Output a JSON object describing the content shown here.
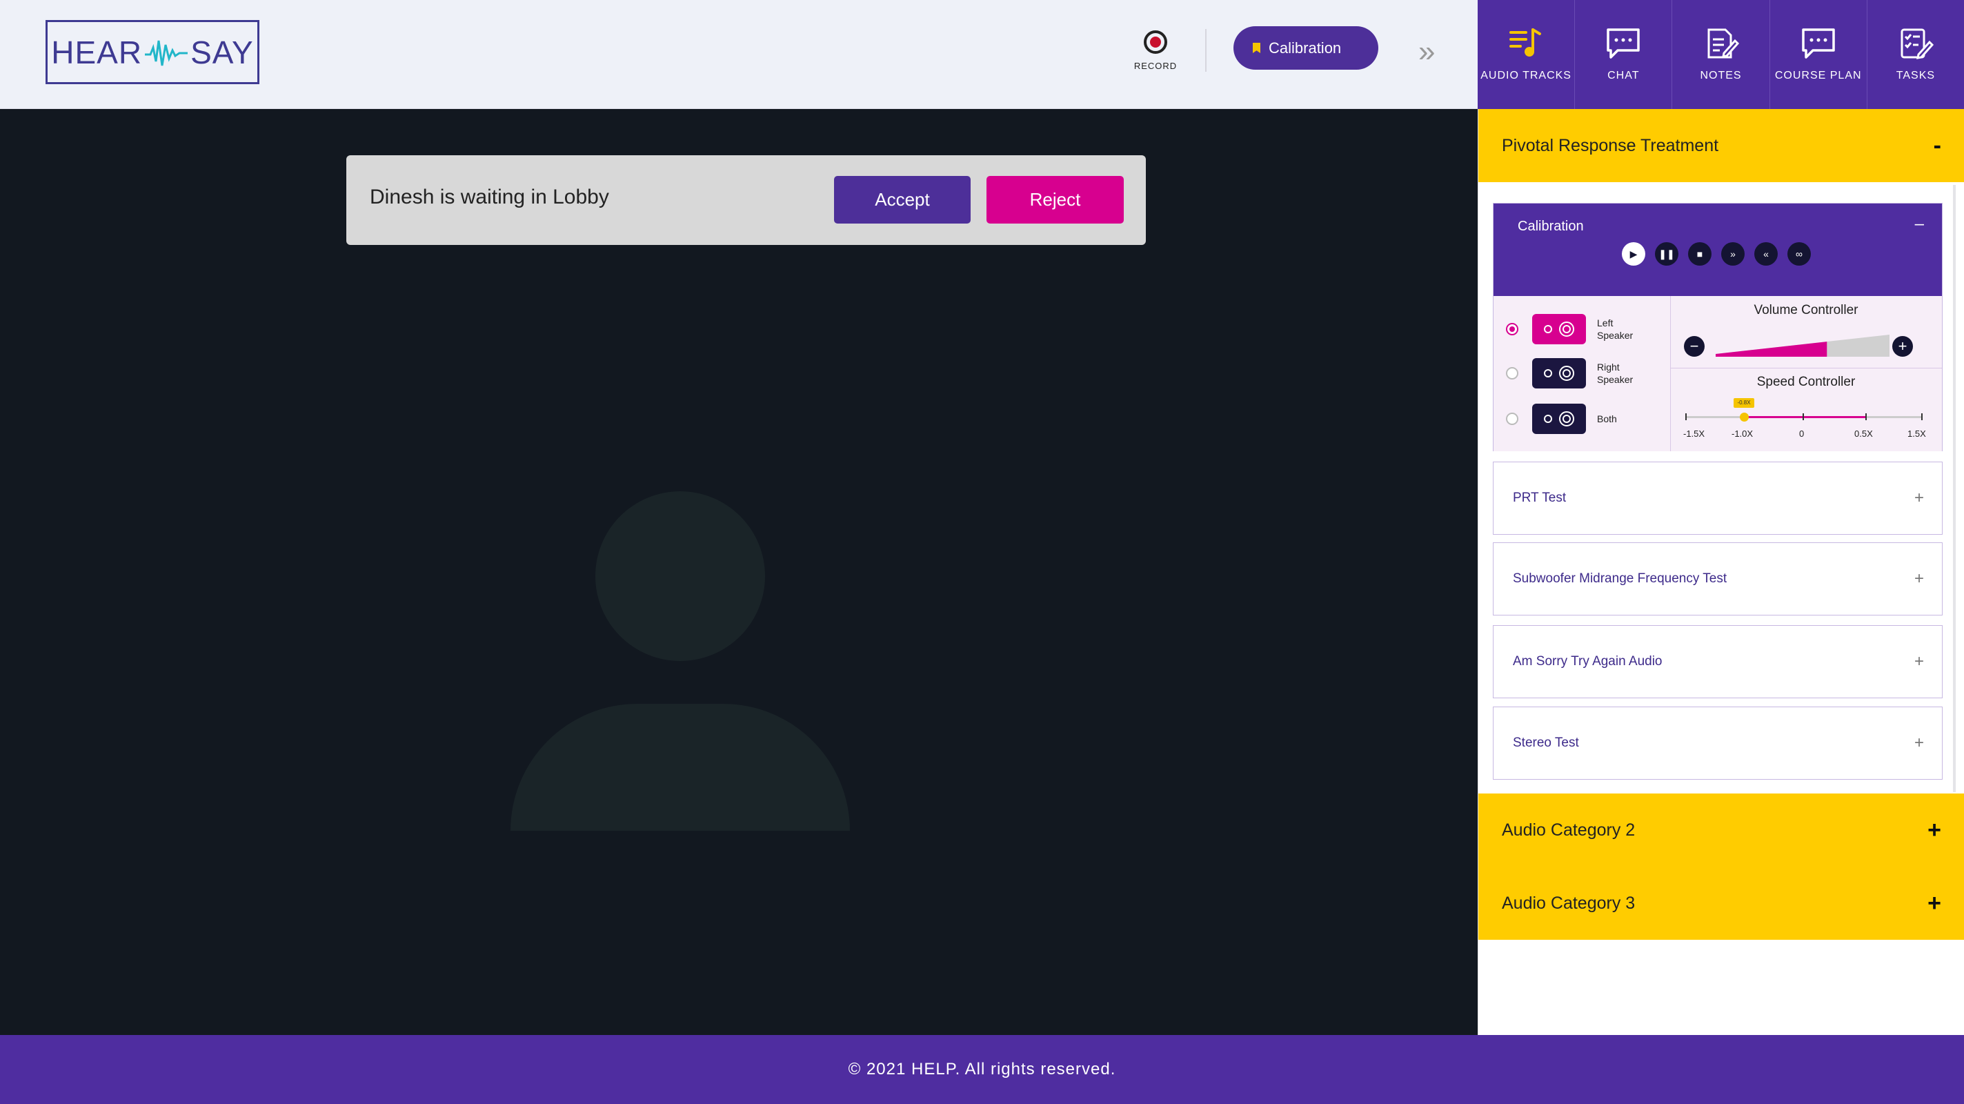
{
  "brand": {
    "left": "HEAR",
    "right": "SAY"
  },
  "header": {
    "record_label": "RECORD",
    "calibration_label": "Calibration",
    "chevron": "»"
  },
  "nav": [
    {
      "label": "AUDIO TRACKS",
      "icon": "audio-tracks-icon",
      "active": true
    },
    {
      "label": "CHAT",
      "icon": "chat-icon"
    },
    {
      "label": "NOTES",
      "icon": "notes-icon"
    },
    {
      "label": "COURSE PLAN",
      "icon": "course-plan-icon"
    },
    {
      "label": "TASKS",
      "icon": "tasks-icon"
    }
  ],
  "lobby": {
    "message": "Dinesh is waiting in Lobby",
    "accept_label": "Accept",
    "reject_label": "Reject"
  },
  "panel": {
    "category1": {
      "title": "Pivotal Response Treatment",
      "toggle": "-"
    },
    "calibration": {
      "title": "Calibration",
      "toggle": "–",
      "speakers": [
        {
          "label": "Left Speaker",
          "selected": true
        },
        {
          "label": "Right Speaker",
          "selected": false
        },
        {
          "label": "Both",
          "selected": false
        }
      ],
      "volume": {
        "title": "Volume Controller",
        "minus": "−",
        "plus": "+",
        "level_fraction": 0.64
      },
      "speed": {
        "title": "Speed Controller",
        "knob_label": "-0.8X",
        "ticks": [
          "-1.5X",
          "-1.0X",
          "0",
          "0.5X",
          "1.5X"
        ]
      }
    },
    "tracks": [
      {
        "title": "PRT Test",
        "toggle": "+"
      },
      {
        "title": "Subwoofer Midrange Frequency Test",
        "toggle": "+"
      },
      {
        "title": "Am Sorry Try Again Audio",
        "toggle": "+"
      },
      {
        "title": "Stereo Test",
        "toggle": "+"
      }
    ],
    "category2": {
      "title": "Audio Category 2",
      "toggle": "+"
    },
    "category3": {
      "title": "Audio Category 3",
      "toggle": "+"
    }
  },
  "footer": {
    "text": "© 2021 HELP. All rights reserved."
  },
  "colors": {
    "primary": "#4f2da0",
    "accent": "#d7008f",
    "yellow": "#ffcc00",
    "stage": "#121820"
  }
}
